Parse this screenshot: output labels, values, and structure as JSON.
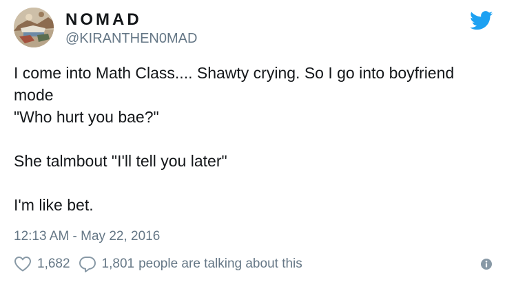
{
  "author": {
    "display_name": "NOMAD",
    "handle": "@KIRANTHEN0MAD",
    "avatar_icon": "avatar-image"
  },
  "brand": {
    "logo_icon": "twitter-bird-icon",
    "color": "#1da1f2"
  },
  "tweet": {
    "lines": [
      "I come into Math Class.... Shawty crying. So I go into boyfriend",
      "mode",
      "\"Who hurt you bae?\"",
      "",
      "She talmbout \"I'll tell you later\"",
      "",
      "I'm like bet."
    ],
    "timestamp": "12:13 AM - May 22, 2016"
  },
  "actions": {
    "likes": "1,682",
    "replies": "1,801",
    "talking_text": "people are talking about this",
    "like_icon": "heart-icon",
    "reply_icon": "speech-bubble-icon",
    "info_icon": "info-icon"
  },
  "colors": {
    "text": "#14171a",
    "secondary": "#657786",
    "icon_gray": "#8899a6"
  }
}
